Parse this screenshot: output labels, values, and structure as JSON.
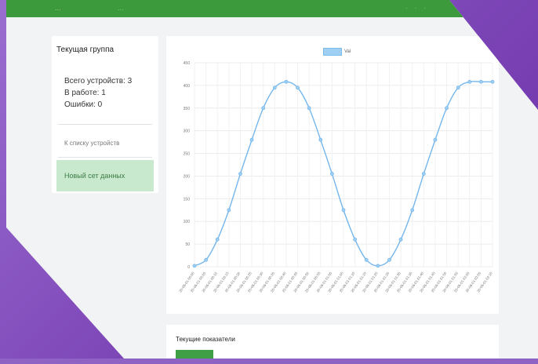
{
  "topbar": {
    "brand": "...",
    "nav": "...",
    "right": "· · ·"
  },
  "sidebar": {
    "title": "Текущая группа",
    "stats": [
      "Всего устройств: 3",
      "В работе: 1",
      "Ошибки: 0"
    ],
    "link": "К списку устройств",
    "button": "Новый сет данных"
  },
  "bottom": {
    "title": "Текущие показатели",
    "badge": ""
  },
  "colors": {
    "accent": "#3c9a3c",
    "line": "#74b6ec",
    "fill": "#9fd0f3"
  },
  "chart_data": {
    "type": "line",
    "legend": [
      "Val"
    ],
    "ylim": [
      0,
      450
    ],
    "yticks": [
      0,
      50,
      100,
      150,
      200,
      250,
      300,
      350,
      400,
      450
    ],
    "x": [
      "20-06-01 00:00",
      "20-06-01 00:05",
      "20-06-01 00:10",
      "20-06-01 00:15",
      "20-06-01 00:20",
      "20-06-01 00:25",
      "20-06-01 00:30",
      "20-06-01 00:35",
      "20-06-01 00:40",
      "20-06-01 00:45",
      "20-06-01 00:50",
      "20-06-01 00:55",
      "20-06-01 01:00",
      "20-06-01 01:05",
      "20-06-01 01:10",
      "20-06-01 01:15",
      "20-06-01 01:20",
      "20-06-01 01:25",
      "20-06-01 01:30",
      "20-06-01 01:35",
      "20-06-01 01:40",
      "20-06-01 01:45",
      "20-06-01 01:50",
      "20-06-01 01:55",
      "20-06-01 02:00",
      "20-06-01 02:05",
      "20-06-01 02:10"
    ],
    "series": [
      {
        "name": "Val",
        "values": [
          2,
          15,
          60,
          125,
          205,
          280,
          350,
          395,
          408,
          395,
          350,
          280,
          205,
          125,
          60,
          15,
          2,
          15,
          60,
          125,
          205,
          280,
          350,
          395,
          408,
          408,
          408
        ]
      }
    ]
  }
}
